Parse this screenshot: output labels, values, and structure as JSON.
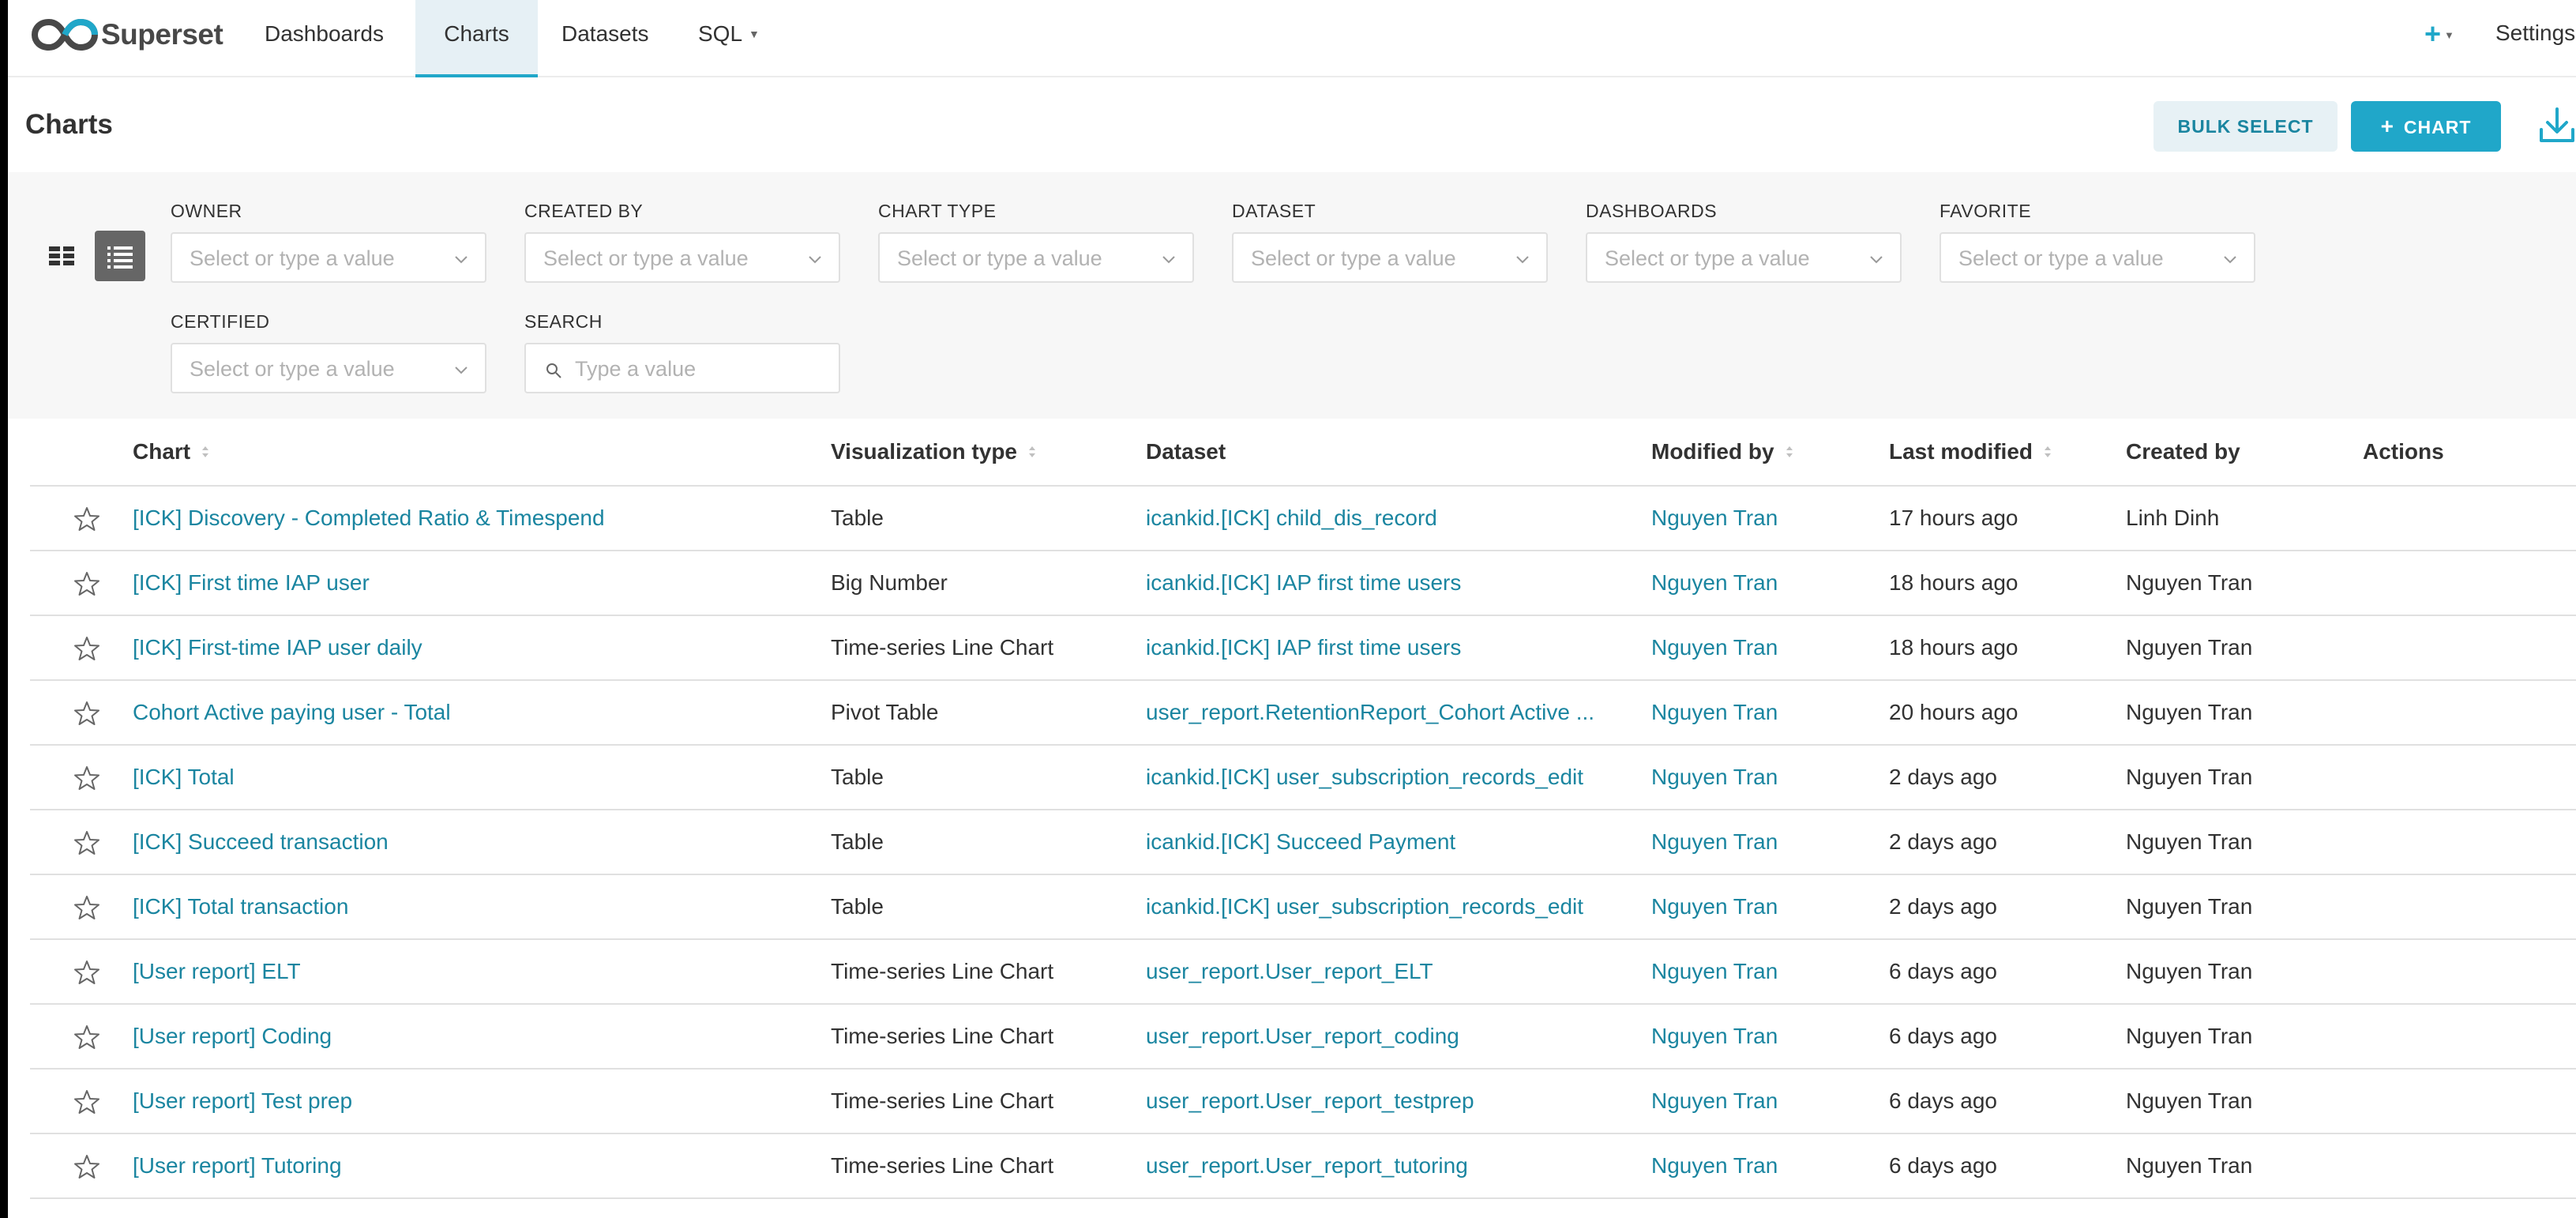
{
  "app": {
    "brand": "Superset"
  },
  "nav": {
    "items": [
      {
        "label": "Dashboards"
      },
      {
        "label": "Charts"
      },
      {
        "label": "Datasets"
      },
      {
        "label": "SQL"
      }
    ],
    "settings": "Settings"
  },
  "header": {
    "title": "Charts",
    "bulk_select": "BULK SELECT",
    "add_chart": "CHART"
  },
  "filters": {
    "owner": {
      "label": "OWNER",
      "placeholder": "Select or type a value"
    },
    "created_by": {
      "label": "CREATED BY",
      "placeholder": "Select or type a value"
    },
    "chart_type": {
      "label": "CHART TYPE",
      "placeholder": "Select or type a value"
    },
    "dataset": {
      "label": "DATASET",
      "placeholder": "Select or type a value"
    },
    "dashboards": {
      "label": "DASHBOARDS",
      "placeholder": "Select or type a value"
    },
    "favorite": {
      "label": "FAVORITE",
      "placeholder": "Select or type a value"
    },
    "certified": {
      "label": "CERTIFIED",
      "placeholder": "Select or type a value"
    },
    "search": {
      "label": "SEARCH",
      "placeholder": "Type a value"
    }
  },
  "table": {
    "columns": {
      "chart": "Chart",
      "viz_type": "Visualization type",
      "dataset": "Dataset",
      "modified_by": "Modified by",
      "last_modified": "Last modified",
      "created_by": "Created by",
      "actions": "Actions"
    },
    "rows": [
      {
        "chart": "[ICK] Discovery - Completed Ratio & Timespend",
        "viz_type": "Table",
        "dataset": "icankid.[ICK] child_dis_record",
        "modified_by": "Nguyen Tran",
        "last_modified": "17 hours ago",
        "created_by": "Linh Dinh"
      },
      {
        "chart": "[ICK] First time IAP user",
        "viz_type": "Big Number",
        "dataset": "icankid.[ICK] IAP first time users",
        "modified_by": "Nguyen Tran",
        "last_modified": "18 hours ago",
        "created_by": "Nguyen Tran"
      },
      {
        "chart": "[ICK] First-time IAP user daily",
        "viz_type": "Time-series Line Chart",
        "dataset": "icankid.[ICK] IAP first time users",
        "modified_by": "Nguyen Tran",
        "last_modified": "18 hours ago",
        "created_by": "Nguyen Tran"
      },
      {
        "chart": "Cohort Active paying user - Total",
        "viz_type": "Pivot Table",
        "dataset": "user_report.RetentionReport_Cohort Active ...",
        "modified_by": "Nguyen Tran",
        "last_modified": "20 hours ago",
        "created_by": "Nguyen Tran"
      },
      {
        "chart": "[ICK] Total",
        "viz_type": "Table",
        "dataset": "icankid.[ICK] user_subscription_records_edit",
        "modified_by": "Nguyen Tran",
        "last_modified": "2 days ago",
        "created_by": "Nguyen Tran"
      },
      {
        "chart": "[ICK] Succeed transaction",
        "viz_type": "Table",
        "dataset": "icankid.[ICK] Succeed Payment",
        "modified_by": "Nguyen Tran",
        "last_modified": "2 days ago",
        "created_by": "Nguyen Tran"
      },
      {
        "chart": "[ICK] Total transaction",
        "viz_type": "Table",
        "dataset": "icankid.[ICK] user_subscription_records_edit",
        "modified_by": "Nguyen Tran",
        "last_modified": "2 days ago",
        "created_by": "Nguyen Tran"
      },
      {
        "chart": "[User report] ELT",
        "viz_type": "Time-series Line Chart",
        "dataset": "user_report.User_report_ELT",
        "modified_by": "Nguyen Tran",
        "last_modified": "6 days ago",
        "created_by": "Nguyen Tran"
      },
      {
        "chart": "[User report] Coding",
        "viz_type": "Time-series Line Chart",
        "dataset": "user_report.User_report_coding",
        "modified_by": "Nguyen Tran",
        "last_modified": "6 days ago",
        "created_by": "Nguyen Tran"
      },
      {
        "chart": "[User report] Test prep",
        "viz_type": "Time-series Line Chart",
        "dataset": "user_report.User_report_testprep",
        "modified_by": "Nguyen Tran",
        "last_modified": "6 days ago",
        "created_by": "Nguyen Tran"
      },
      {
        "chart": "[User report] Tutoring",
        "viz_type": "Time-series Line Chart",
        "dataset": "user_report.User_report_tutoring",
        "modified_by": "Nguyen Tran",
        "last_modified": "6 days ago",
        "created_by": "Nguyen Tran"
      }
    ]
  },
  "colors": {
    "accent": "#20a7c9",
    "link": "#1a85a0",
    "text": "#323232",
    "filter_bg": "#f7f7f7"
  },
  "icons": [
    "superset-logo-icon",
    "plus-icon",
    "import-icon",
    "card-view-icon",
    "list-view-icon",
    "chevron-down-icon",
    "search-icon",
    "sort-icon",
    "star-icon"
  ]
}
